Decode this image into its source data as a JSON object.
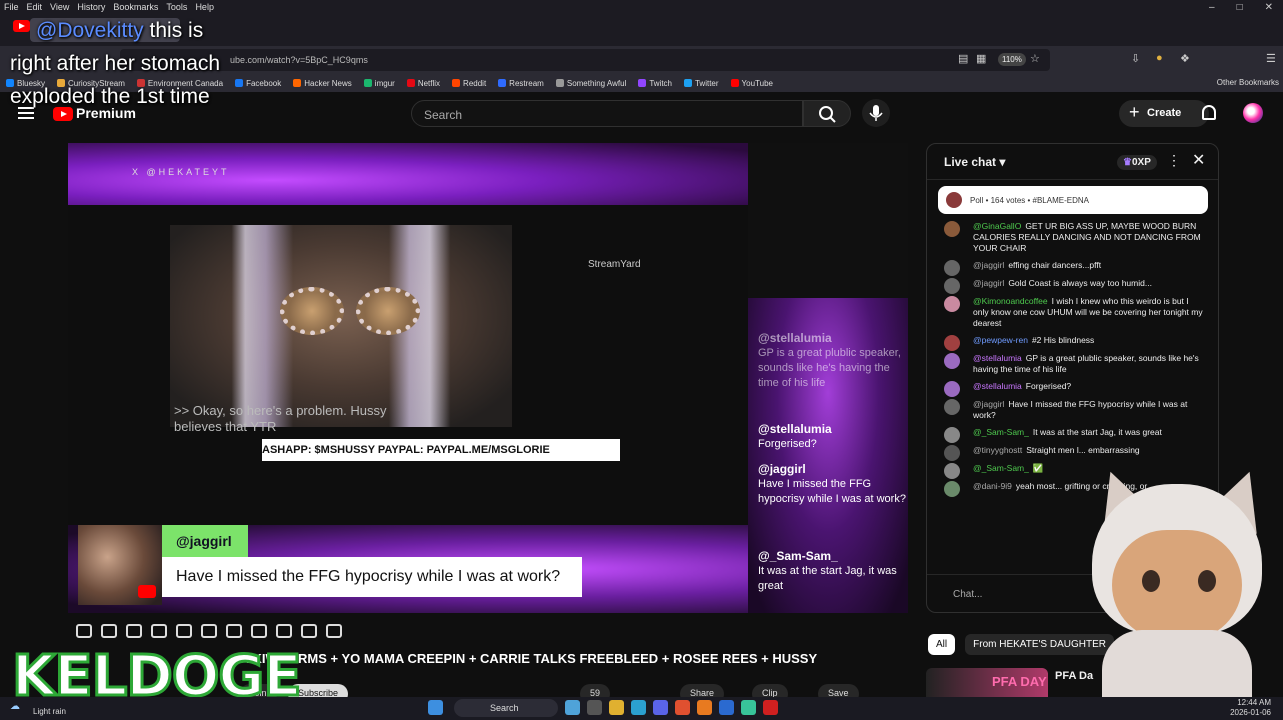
{
  "browser": {
    "menu": [
      "File",
      "Edit",
      "View",
      "History",
      "Bookmarks",
      "Tools",
      "Help"
    ],
    "url": "ube.com/watch?v=5BpC_HC9qms",
    "zoom": "110%",
    "bookmarks": [
      {
        "label": "Bluesky",
        "color": "#1185fe"
      },
      {
        "label": "CuriosityStream",
        "color": "#e8a93a"
      },
      {
        "label": "Environment Canada",
        "color": "#c33"
      },
      {
        "label": "Facebook",
        "color": "#1877f2"
      },
      {
        "label": "Hacker News",
        "color": "#ff6600"
      },
      {
        "label": "imgur",
        "color": "#1bb76e"
      },
      {
        "label": "Netflix",
        "color": "#e50914"
      },
      {
        "label": "Reddit",
        "color": "#ff4500"
      },
      {
        "label": "Restream",
        "color": "#2f6bff"
      },
      {
        "label": "Something Awful",
        "color": "#999"
      },
      {
        "label": "Twitch",
        "color": "#9146ff"
      },
      {
        "label": "Twitter",
        "color": "#1da1f2"
      },
      {
        "label": "YouTube",
        "color": "#ff0000"
      }
    ],
    "other_bookmarks": "Other Bookmarks"
  },
  "caption": {
    "mention": "@Dovekitty",
    "text_line1": "this is",
    "text_line2": "right after her stomach",
    "text_line3": "exploded the 1st time"
  },
  "youtube": {
    "brand": "Premium",
    "search_placeholder": "Search",
    "create_label": "Create"
  },
  "video": {
    "banner_text": "X @HEKATEYT",
    "streamyard": "StreamYard",
    "cc_text_1": ">> Okay, so here's a problem. Hussy",
    "cc_text_2": "believes that YTR",
    "ticker": "ASHAPP: $MSHUSSY PAYPAL: PAYPAL.ME/MSGLORIE",
    "featured_user": "@jaggirl",
    "featured_message": "Have I missed the FFG hypocrisy while I was at work?",
    "overlay_chat": [
      {
        "user": "@stellalumia",
        "text": "GP is a great plublic speaker, sounds like he's having the time of his life",
        "dim": true
      },
      {
        "user": "@stellalumia",
        "text": "Forgerised?",
        "dim": false
      },
      {
        "user": "@jaggirl",
        "text": "Have I missed the FFG hypocrisy while I was at work?",
        "dim": false
      },
      {
        "user": "@_Sam-Sam_",
        "text": "It was at the start Jag, it was great",
        "dim": false
      }
    ]
  },
  "title": {
    "prefix": "H",
    "main": "A KIWIFARMS + YO MAMA CREEPIN + CARRIE TALKS FREEBLEED + ROSEE REES + HUSSY"
  },
  "actions": {
    "join": "Join",
    "subscribe": "Subscribe",
    "likes": "59",
    "share": "Share",
    "clip": "Clip",
    "save": "Save"
  },
  "keldoge": "KELDOGE",
  "chat": {
    "title": "Live chat",
    "xp": "0XP",
    "poll": "Poll • 164 votes • #BLAME-EDNA",
    "input_placeholder": "Chat...",
    "messages": [
      {
        "user": "@GinaGallO",
        "color": "g",
        "text": "GET UR BIG ASS UP, MAYBE WOOD BURN CALORIES REALLY DANCING AND NOT DANCING FROM YOUR CHAIR",
        "avatar": "#8a5a3a"
      },
      {
        "user": "@jaggirl",
        "color": "",
        "text": "effing chair dancers...pfft",
        "avatar": "#777"
      },
      {
        "user": "@jaggirl",
        "color": "",
        "text": "Gold Coast is always way too humid...",
        "avatar": "#777"
      },
      {
        "user": "@Kimonoandcoffee",
        "color": "g",
        "text": "I wish I knew who this weirdo is but I only know one cow UHUM will we be covering her tonight my dearest",
        "avatar": "#c98aa0"
      },
      {
        "user": "@pewpew-ren",
        "color": "b",
        "text": "#2  His blindness",
        "avatar": "#a04040"
      },
      {
        "user": "@stellalumia",
        "color": "p",
        "text": "GP is a great plublic speaker, sounds like he's having the time of his life",
        "avatar": "#9a6ac0"
      },
      {
        "user": "@stellalumia",
        "color": "p",
        "text": "Forgerised?",
        "avatar": "#9a6ac0"
      },
      {
        "user": "@jaggirl",
        "color": "",
        "text": "Have I missed the FFG hypocrisy while I was at work?",
        "avatar": "#777"
      },
      {
        "user": "@_Sam-Sam_",
        "color": "g",
        "text": "It was at the start Jag, it was great",
        "avatar": "#888"
      },
      {
        "user": "@tinyyghostt",
        "color": "",
        "text": "Straight men l... embarrassing",
        "avatar": "#555"
      },
      {
        "user": "@_Sam-Sam_",
        "color": "g",
        "text": "✅",
        "avatar": "#888"
      },
      {
        "user": "@dani-9i9",
        "color": "",
        "text": "yeah most... grifting or creeping, or",
        "avatar": "#6a8a6a"
      }
    ]
  },
  "chips": [
    "All",
    "From HEKATE'S DAUGHTER"
  ],
  "recommended": {
    "thumb_text": "PFA DAY",
    "title": "PFA Da"
  },
  "taskbar": {
    "weather": "Light rain",
    "search": "Search",
    "time": "12:44 AM",
    "date": "2026-01-06"
  }
}
